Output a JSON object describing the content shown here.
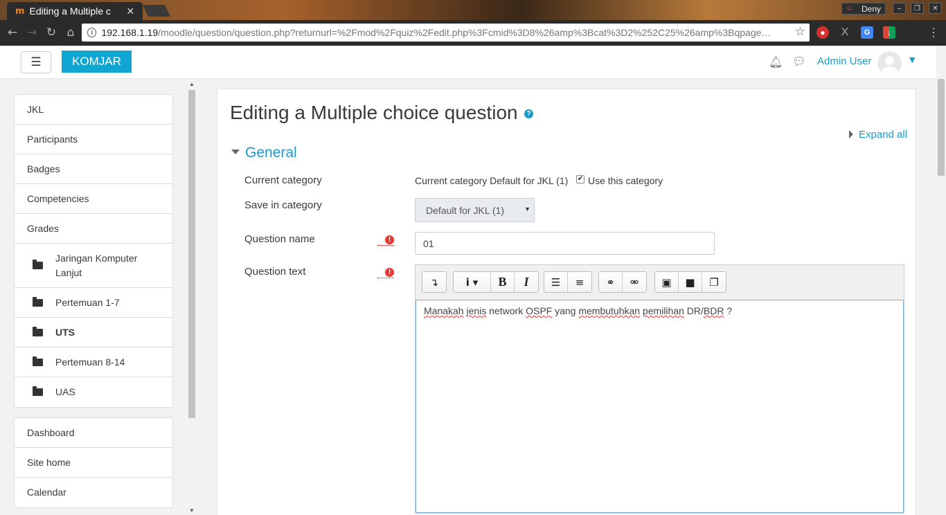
{
  "browser": {
    "tab_title": "Editing a Multiple c",
    "tab_favicon": "m",
    "profile_name": "Deny",
    "url_host": "192.168.1.19",
    "url_path": "/moodle/question/question.php?returnurl=%2Fmod%2Fquiz%2Fedit.php%3Fcmid%3D8%26amp%3Bcat%3D2%252C25%26amp%3Bqpage…"
  },
  "header": {
    "site_name": "KOMJAR",
    "user_name": "Admin User"
  },
  "sidebar": {
    "course_items": [
      {
        "label": "JKL"
      },
      {
        "label": "Participants"
      },
      {
        "label": "Badges"
      },
      {
        "label": "Competencies"
      },
      {
        "label": "Grades"
      }
    ],
    "sections": [
      {
        "label": "Jaringan Komputer Lanjut"
      },
      {
        "label": "Pertemuan 1-7"
      },
      {
        "label": "UTS"
      },
      {
        "label": "Pertemuan 8-14"
      },
      {
        "label": "UAS"
      }
    ],
    "site_items": [
      {
        "label": "Dashboard"
      },
      {
        "label": "Site home"
      },
      {
        "label": "Calendar"
      }
    ]
  },
  "main": {
    "title": "Editing a Multiple choice question",
    "expand_all": "Expand all",
    "section": "General",
    "fields": {
      "current_category_label": "Current category",
      "current_category_value": "Current category Default for JKL (1)",
      "use_category_label": "Use this category",
      "use_category_checked": true,
      "save_category_label": "Save in category",
      "save_category_value": "Default for JKL (1)",
      "question_name_label": "Question name",
      "question_name_value": "01",
      "question_text_label": "Question text"
    },
    "editor": {
      "content_parts": [
        "Manakah",
        " ",
        "jenis",
        " network ",
        "OSPF",
        " yang ",
        "membutuhkan",
        " ",
        "pemilihan",
        " DR/",
        "BDR",
        " ?"
      ]
    }
  },
  "colors": {
    "brand": "#0fa6d1",
    "link": "#1a9bc7",
    "required": "#e53935"
  }
}
